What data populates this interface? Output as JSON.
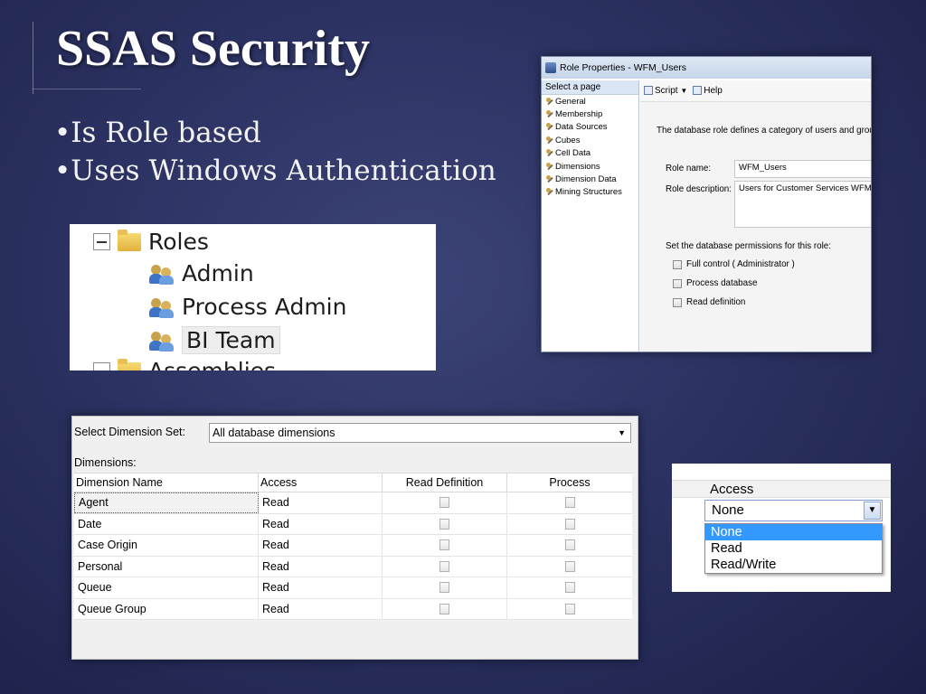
{
  "slide": {
    "title": "SSAS Security",
    "bullets": [
      "Is Role based",
      "Uses Windows Authentication"
    ]
  },
  "role_window": {
    "title": "Role Properties - WFM_Users",
    "select_page_label": "Select a page",
    "pages": [
      "General",
      "Membership",
      "Data Sources",
      "Cubes",
      "Cell Data",
      "Dimensions",
      "Dimension Data",
      "Mining Structures"
    ],
    "toolbar": {
      "script_label": "Script",
      "help_label": "Help"
    },
    "description": "The database role defines a category of users and groups tha",
    "role_name_label": "Role name:",
    "role_name_value": "WFM_Users",
    "role_description_label": "Role description:",
    "role_description_value": "Users for Customer Services WFM",
    "permissions_label": "Set the database permissions for this role:",
    "permissions": [
      {
        "label": "Full control ( Administrator )",
        "checked": false
      },
      {
        "label": "Process database",
        "checked": false
      },
      {
        "label": "Read definition",
        "checked": false
      }
    ]
  },
  "roles_tree": {
    "folder_label": "Roles",
    "roles": [
      "Admin",
      "Process Admin",
      "BI Team"
    ],
    "selected": "BI Team",
    "next_folder_label": "Assemblies"
  },
  "dimensions_panel": {
    "select_label": "Select Dimension Set:",
    "select_value": "All database dimensions",
    "dimensions_label": "Dimensions:",
    "columns": [
      "Dimension Name",
      "Access",
      "Read Definition",
      "Process"
    ],
    "rows": [
      {
        "name": "Agent",
        "access": "Read"
      },
      {
        "name": "Date",
        "access": "Read"
      },
      {
        "name": "Case Origin",
        "access": "Read"
      },
      {
        "name": "Personal",
        "access": "Read"
      },
      {
        "name": "Queue",
        "access": "Read"
      },
      {
        "name": "Queue Group",
        "access": "Read"
      }
    ]
  },
  "access_dropdown": {
    "header": "Access",
    "selected": "None",
    "options": [
      "None",
      "Read",
      "Read/Write"
    ],
    "highlighted": "None"
  },
  "colors": {
    "background": "#2c3262",
    "highlight": "#3399ff"
  }
}
